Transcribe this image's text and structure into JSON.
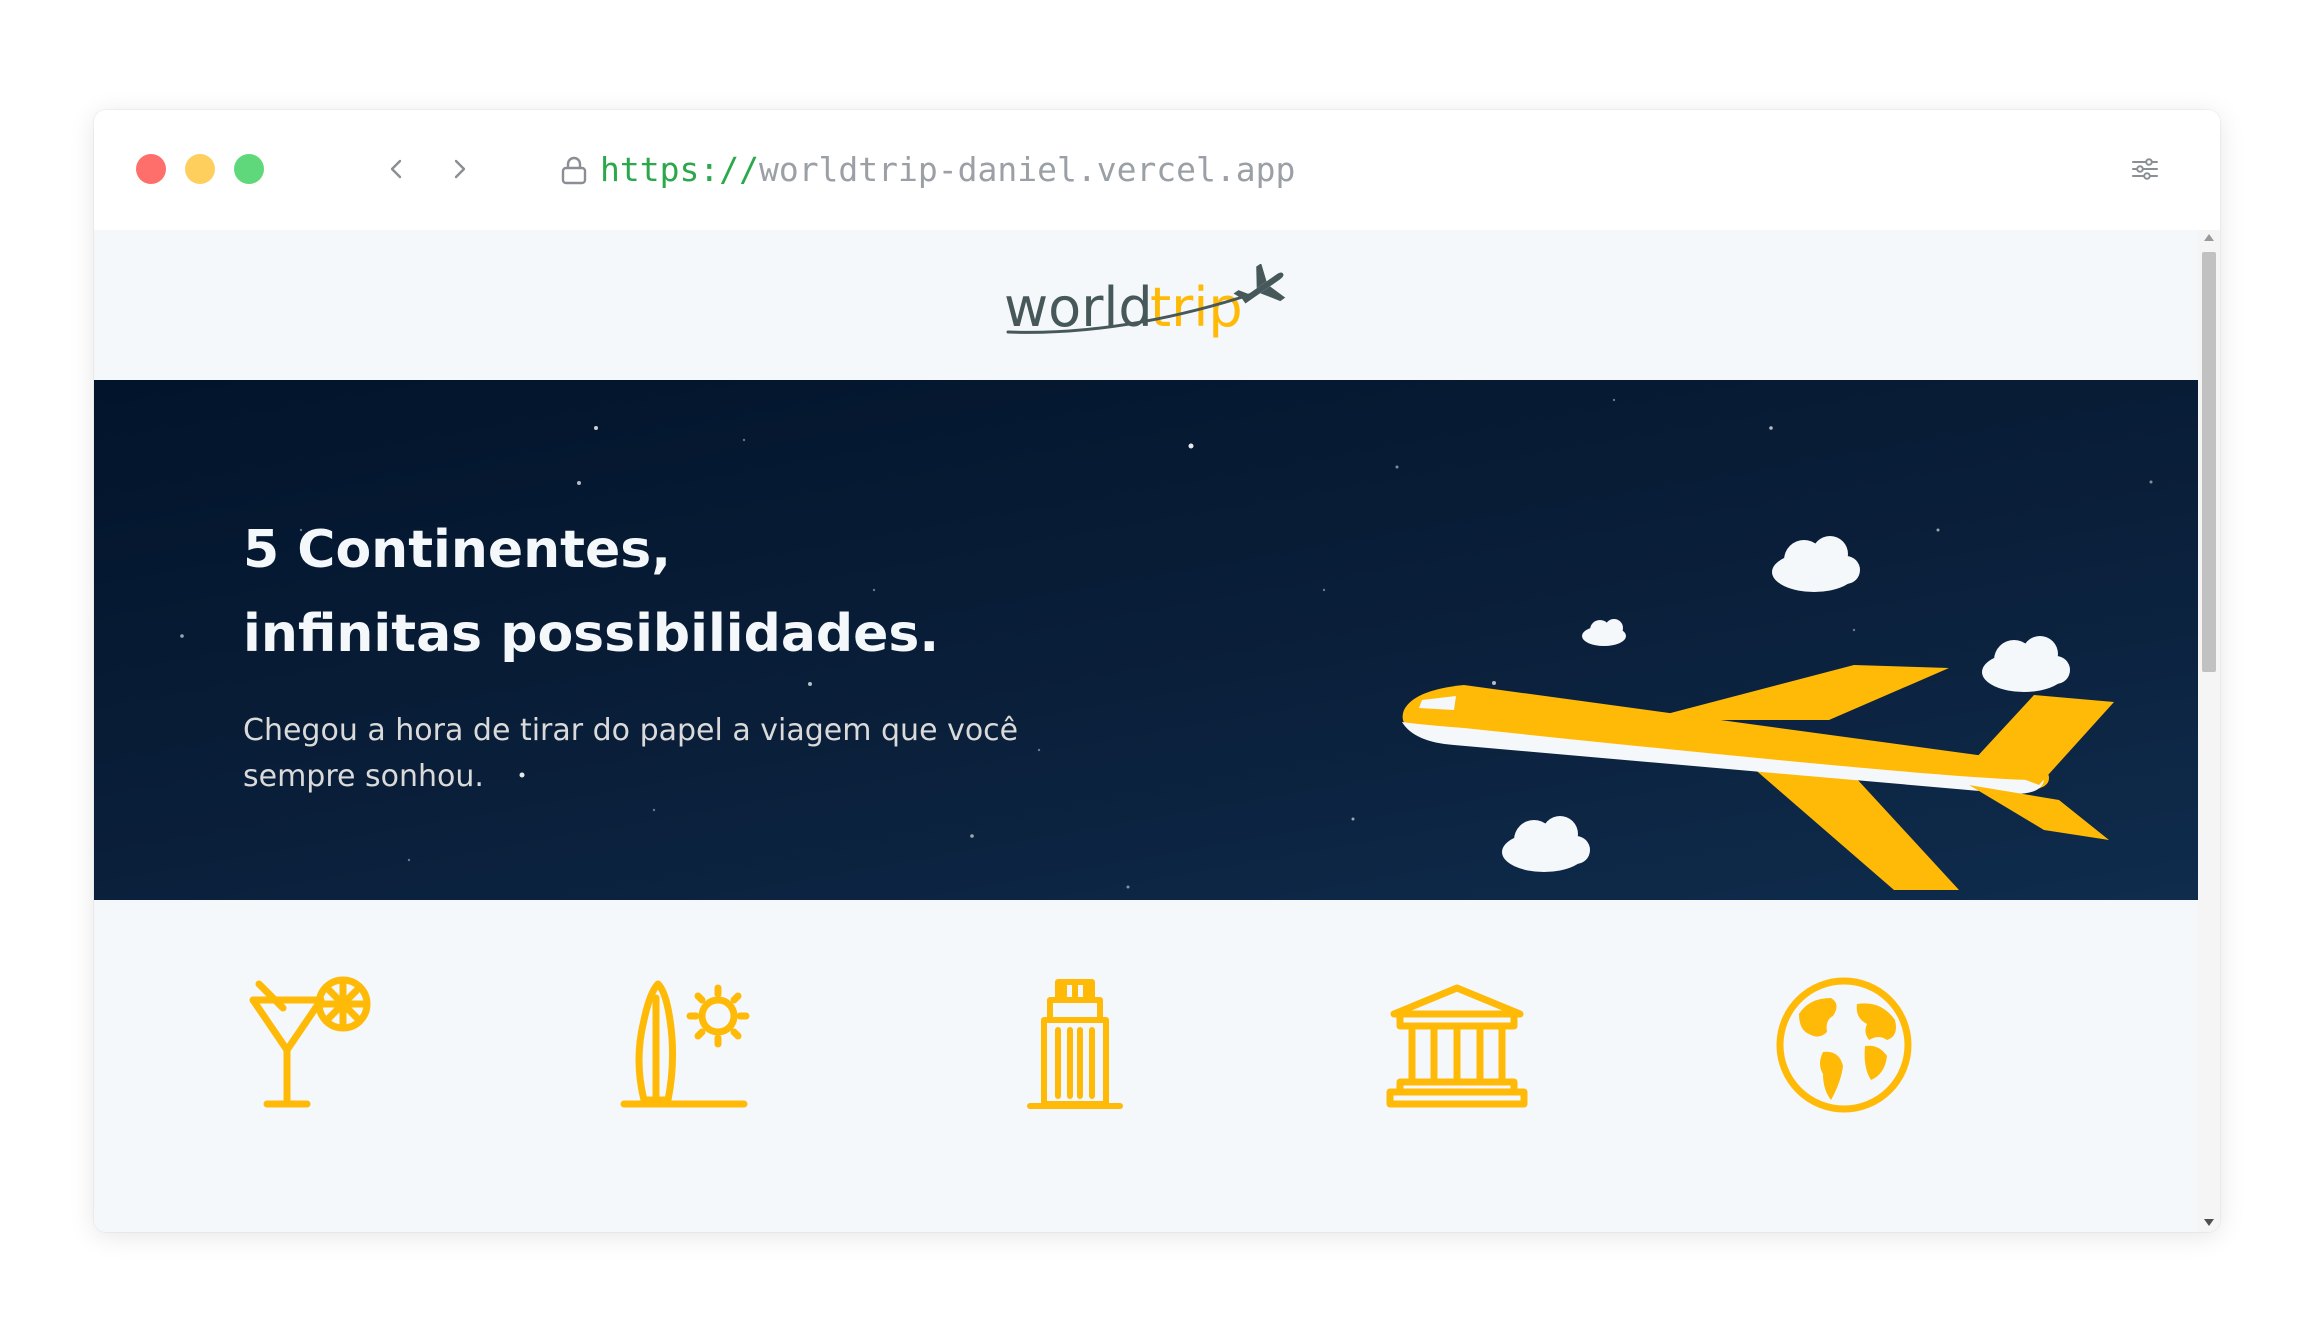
{
  "browser": {
    "url_protocol": "https://",
    "url_host": "worldtrip-daniel.vercel.app"
  },
  "logo": {
    "brand_world": "world",
    "brand_trip": "trip"
  },
  "banner": {
    "headline_line1": "5 Continentes,",
    "headline_line2": "infinitas possibilidades.",
    "subtext": "Chegou a hora de tirar do papel a viagem que você sempre sonhou."
  },
  "travel_types": [
    {
      "icon": "cocktail-icon"
    },
    {
      "icon": "surfboard-sun-icon"
    },
    {
      "icon": "skyscraper-icon"
    },
    {
      "icon": "museum-icon"
    },
    {
      "icon": "globe-icon"
    }
  ],
  "colors": {
    "accent": "#ffba08",
    "dark_text": "#47585b",
    "banner_bg": "#0a1f3a",
    "page_bg": "#f5f8fa"
  }
}
